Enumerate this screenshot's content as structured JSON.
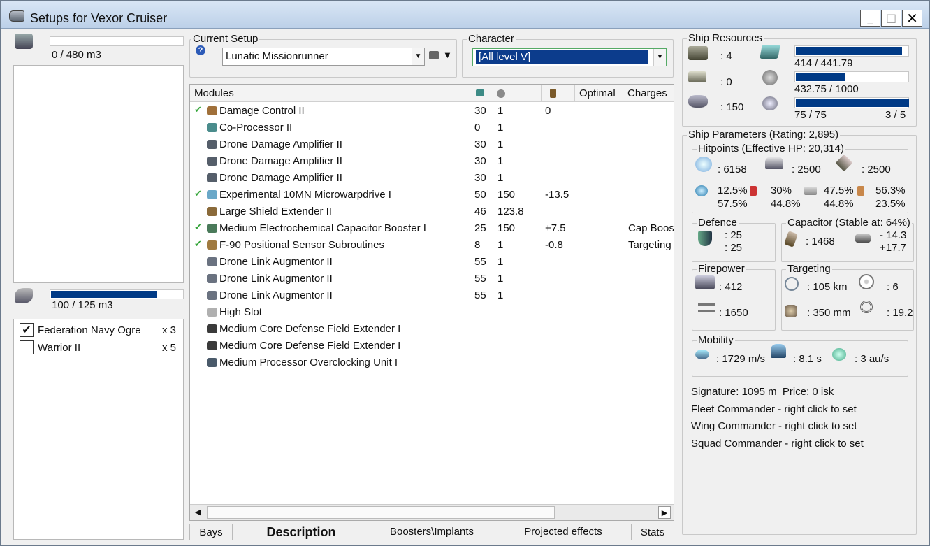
{
  "window": {
    "title": "Setups for Vexor Cruiser",
    "minimize": "_",
    "maximize": "□",
    "close": "✕"
  },
  "left": {
    "cargo_text": "0 / 480 m3",
    "cargo_fill_fraction": 0.0,
    "dronebay_text": "100 / 125 m3",
    "dronebay_fill_fraction": 0.8,
    "drones": [
      {
        "name": "Federation Navy Ogre",
        "qty": "x 3",
        "checked": true
      },
      {
        "name": "Warrior II",
        "qty": "x 5",
        "checked": false
      }
    ],
    "check_mark": "✔"
  },
  "setup": {
    "legend": "Current Setup",
    "value": "Lunatic Missionrunner",
    "help": "?"
  },
  "character": {
    "legend": "Character",
    "value": "[All level V]"
  },
  "modules": {
    "headers": {
      "name": "Modules",
      "optimal": "Optimal",
      "charges": "Charges"
    },
    "checkmark": "✔",
    "rows": [
      {
        "name": "Damage Control II",
        "cpu": "30",
        "pg": "1",
        "cap": "0",
        "charges": "",
        "online": true,
        "color": "#a0703a"
      },
      {
        "name": "Co-Processor II",
        "cpu": "0",
        "pg": "1",
        "cap": "",
        "charges": "",
        "online": false,
        "color": "#4a8c8c"
      },
      {
        "name": "Drone Damage Amplifier II",
        "cpu": "30",
        "pg": "1",
        "cap": "",
        "charges": "",
        "online": false,
        "color": "#555e6a"
      },
      {
        "name": "Drone Damage Amplifier II",
        "cpu": "30",
        "pg": "1",
        "cap": "",
        "charges": "",
        "online": false,
        "color": "#555e6a"
      },
      {
        "name": "Drone Damage Amplifier II",
        "cpu": "30",
        "pg": "1",
        "cap": "",
        "charges": "",
        "online": false,
        "color": "#555e6a"
      },
      {
        "name": "Experimental 10MN Microwarpdrive I",
        "cpu": "50",
        "pg": "150",
        "cap": "-13.5",
        "charges": "",
        "online": true,
        "color": "#6aa8c8"
      },
      {
        "name": "Large Shield Extender II",
        "cpu": "46",
        "pg": "123.8",
        "cap": "",
        "charges": "",
        "online": false,
        "color": "#8a6a3a"
      },
      {
        "name": "Medium Electrochemical Capacitor Booster I",
        "cpu": "25",
        "pg": "150",
        "cap": "+7.5",
        "charges": "Cap Boos",
        "online": true,
        "color": "#4a7a5a"
      },
      {
        "name": "F-90 Positional Sensor Subroutines",
        "cpu": "8",
        "pg": "1",
        "cap": "-0.8",
        "charges": "Targeting",
        "online": true,
        "color": "#a07a40"
      },
      {
        "name": "Drone Link Augmentor II",
        "cpu": "55",
        "pg": "1",
        "cap": "",
        "charges": "",
        "online": false,
        "color": "#6a7280"
      },
      {
        "name": "Drone Link Augmentor II",
        "cpu": "55",
        "pg": "1",
        "cap": "",
        "charges": "",
        "online": false,
        "color": "#6a7280"
      },
      {
        "name": "Drone Link Augmentor II",
        "cpu": "55",
        "pg": "1",
        "cap": "",
        "charges": "",
        "online": false,
        "color": "#6a7280"
      },
      {
        "name": "High Slot",
        "cpu": "",
        "pg": "",
        "cap": "",
        "charges": "",
        "online": false,
        "color": "#b0b0b0"
      },
      {
        "name": "Medium Core Defense Field Extender I",
        "cpu": "",
        "pg": "",
        "cap": "",
        "charges": "",
        "online": false,
        "color": "#3a3a3a"
      },
      {
        "name": "Medium Core Defense Field Extender I",
        "cpu": "",
        "pg": "",
        "cap": "",
        "charges": "",
        "online": false,
        "color": "#3a3a3a"
      },
      {
        "name": "Medium Processor Overclocking Unit I",
        "cpu": "",
        "pg": "",
        "cap": "",
        "charges": "",
        "online": false,
        "color": "#4a5a6a"
      }
    ]
  },
  "tabs": [
    "Bays",
    "Description",
    "Boosters\\Implants",
    "Projected effects",
    "Stats"
  ],
  "resources": {
    "legend": "Ship Resources",
    "turrets": ": 4",
    "launchers": ": 0",
    "calibration": ": 150",
    "cpu_text": "414 / 441.79",
    "cpu_fraction": 0.937,
    "pg_text": "432.75 / 1000",
    "pg_fraction": 0.433,
    "drone_bw_text": "75 / 75",
    "drone_bw_fraction": 1.0,
    "drones_active": "3 / 5"
  },
  "params": {
    "legend": "Ship Parameters (Rating: 2,895)",
    "hitpoints": {
      "legend": "Hitpoints (Effective HP: 20,314)",
      "shield": ": 6158",
      "armor": ": 2500",
      "structure": ": 2500",
      "resist_em_top": "12.5%",
      "resist_em_bot": "57.5%",
      "resist_th_top": "30%",
      "resist_th_bot": "44.8%",
      "resist_ki_top": "47.5%",
      "resist_ki_bot": "44.8%",
      "resist_ex_top": "56.3%",
      "resist_ex_bot": "23.5%"
    },
    "defence": {
      "legend": "Defence",
      "v1": ": 25",
      "v2": ": 25"
    },
    "capacitor": {
      "legend": "Capacitor (Stable at: 64%)",
      "capacity": ": 1468",
      "delta1": "- 14.3",
      "delta2": "+17.7"
    },
    "firepower": {
      "legend": "Firepower",
      "dps": ": 412",
      "volley": ": 1650"
    },
    "targeting": {
      "legend": "Targeting",
      "range": ": 105 km",
      "targets": ": 6",
      "scan_res": ": 350 mm",
      "sensor": ": 19.2"
    },
    "mobility": {
      "legend": "Mobility",
      "speed": ": 1729 m/s",
      "align": ": 8.1 s",
      "warp": ": 3 au/s"
    },
    "signature_line": "Signature: 1095 m  Price: 0 isk",
    "fleet": "Fleet Commander - right click to set",
    "wing": "Wing Commander - right click to set",
    "squad": "Squad Commander - right click to set"
  }
}
